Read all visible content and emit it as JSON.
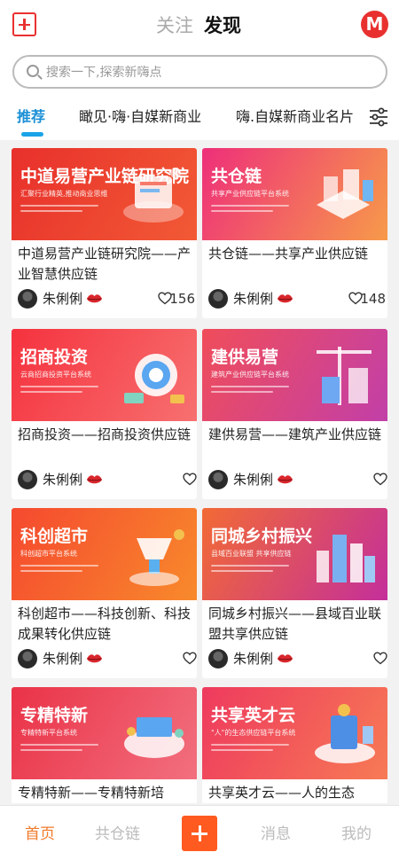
{
  "header": {
    "tabs": [
      {
        "label": "关注",
        "active": false
      },
      {
        "label": "发现",
        "active": true
      }
    ],
    "logo_letter": "M",
    "accent_color": "#e8312f"
  },
  "search": {
    "placeholder": "搜索一下,探索新嗨点"
  },
  "categories": [
    {
      "label": "推荐",
      "active": true
    },
    {
      "label": "瞰见·嗨·自媒新商业",
      "active": false
    },
    {
      "label": "嗨.自媒新商业名片",
      "active": false
    }
  ],
  "cards": [
    {
      "banner_title": "中道易营产业链研究院",
      "banner_sub": "汇聚行业精英,推动商业思维",
      "banner_gradient": [
        "#e8302c",
        "#f25a35"
      ],
      "title": "中道易营产业链研究院——产业智慧供应链",
      "author": "朱俐俐",
      "likes": "156"
    },
    {
      "banner_title": "共仓链",
      "banner_sub": "共享产业供应链平台系统",
      "banner_gradient": [
        "#ee2f7a",
        "#f79a4a"
      ],
      "title": "共仓链——共享产业供应链",
      "author": "朱俐俐",
      "likes": "148"
    },
    {
      "banner_title": "招商投资",
      "banner_sub": "云商招商投资平台系统",
      "banner_gradient": [
        "#f5323e",
        "#f77070"
      ],
      "title": "招商投资——招商投资供应链",
      "author": "朱俐俐",
      "likes": ""
    },
    {
      "banner_title": "建供易营",
      "banner_sub": "建筑产业供应链平台系统",
      "banner_gradient": [
        "#f04d5a",
        "#c23fa8"
      ],
      "title": "建供易营——建筑产业供应链",
      "author": "朱俐俐",
      "likes": ""
    },
    {
      "banner_title": "科创超市",
      "banner_sub": "科创超市平台系统",
      "banner_gradient": [
        "#f5492f",
        "#f88a2c"
      ],
      "title": "科创超市——科技创新、科技成果转化供应链",
      "author": "朱俐俐",
      "likes": ""
    },
    {
      "banner_title": "同城乡村振兴",
      "banner_sub": "县域百业联盟 共享供应链",
      "banner_gradient": [
        "#f26a35",
        "#c42f9a"
      ],
      "title": "同城乡村振兴——县域百业联盟共享供应链",
      "author": "朱俐俐",
      "likes": ""
    },
    {
      "banner_title": "专精特新",
      "banner_sub": "专精特新平台系统",
      "banner_gradient": [
        "#ea3247",
        "#f2707f"
      ],
      "title": "专精特新——专精特新培",
      "author": "朱俐俐",
      "likes": ""
    },
    {
      "banner_title": "共享英才云",
      "banner_sub": "\"人\"的生态供应链平台系统",
      "banner_gradient": [
        "#ee3a5e",
        "#f77a55"
      ],
      "title": "共享英才云——人的生态",
      "author": "朱俐俐",
      "likes": ""
    }
  ],
  "bottom_nav": [
    {
      "label": "首页",
      "active": true
    },
    {
      "label": "共仓链",
      "active": false
    },
    {
      "label": "消息",
      "active": false
    },
    {
      "label": "我的",
      "active": false
    }
  ],
  "bottom_active_color": "#f07a2a"
}
